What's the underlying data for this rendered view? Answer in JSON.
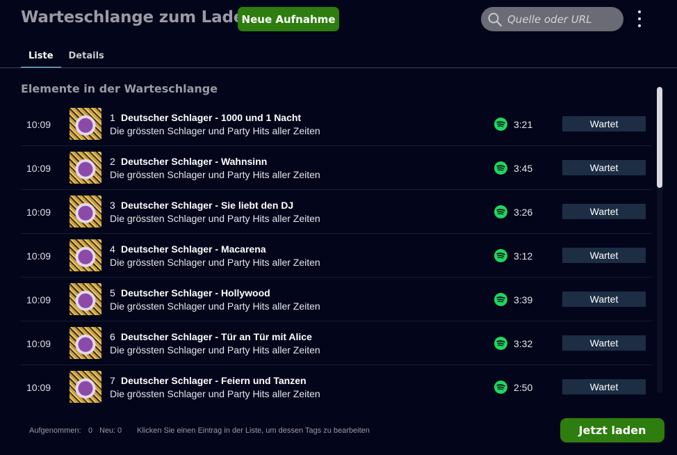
{
  "header": {
    "title": "Warteschlange zum Laden",
    "new_button": "Neue Aufnahme",
    "search_placeholder": "Quelle oder URL",
    "menu_icon": "kebab-menu-icon"
  },
  "tabs": [
    {
      "label": "Liste",
      "active": true
    },
    {
      "label": "Details",
      "active": false
    }
  ],
  "section_title": "Elemente in der Warteschlange",
  "items": [
    {
      "time": "10:09",
      "index": "1",
      "title": "Deutscher Schlager - 1000 und 1 Nacht",
      "album": "Die grössten Schlager und Party Hits aller Zeiten",
      "duration": "3:21",
      "status": "Wartet"
    },
    {
      "time": "10:09",
      "index": "2",
      "title": "Deutscher Schlager - Wahnsinn",
      "album": "Die grössten Schlager und Party Hits aller Zeiten",
      "duration": "3:45",
      "status": "Wartet"
    },
    {
      "time": "10:09",
      "index": "3",
      "title": "Deutscher Schlager - Sie liebt den DJ",
      "album": "Die grössten Schlager und Party Hits aller Zeiten",
      "duration": "3:26",
      "status": "Wartet"
    },
    {
      "time": "10:09",
      "index": "4",
      "title": "Deutscher Schlager - Macarena",
      "album": "Die grössten Schlager und Party Hits aller Zeiten",
      "duration": "3:12",
      "status": "Wartet"
    },
    {
      "time": "10:09",
      "index": "5",
      "title": "Deutscher Schlager - Hollywood",
      "album": "Die grössten Schlager und Party Hits aller Zeiten",
      "duration": "3:39",
      "status": "Wartet"
    },
    {
      "time": "10:09",
      "index": "6",
      "title": "Deutscher Schlager - Tür an Tür mit Alice",
      "album": "Die grössten Schlager und Party Hits aller Zeiten",
      "duration": "3:32",
      "status": "Wartet"
    },
    {
      "time": "10:09",
      "index": "7",
      "title": "Deutscher Schlager - Feiern und Tanzen",
      "album": "Die grössten Schlager und Party Hits aller Zeiten",
      "duration": "2:50",
      "status": "Wartet"
    }
  ],
  "footer": {
    "recorded_label": "Aufgenommen:",
    "recorded_count": "0",
    "new_label": "Neu:",
    "new_count": "0",
    "hint": "Klicken Sie einen Eintrag in der Liste, um dessen Tags zu bearbeiten",
    "load_button": "Jetzt laden"
  },
  "colors": {
    "background": "#03061a",
    "accent_green": "#2e7d0f",
    "tab_underline": "#7fd8f0",
    "status_badge": "#1c2d44",
    "spotify_green": "#1ed760"
  }
}
